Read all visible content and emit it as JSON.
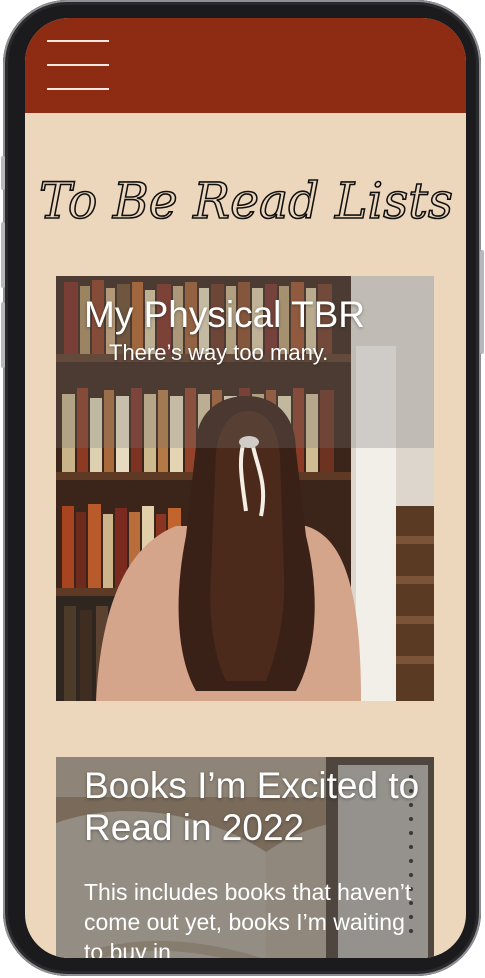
{
  "header": {
    "menu_icon": "hamburger-menu-icon",
    "color": "#8e2c13"
  },
  "page": {
    "title": "To Be Read Lists",
    "background": "#ecd7bd"
  },
  "cards": [
    {
      "title": "My Physical TBR",
      "subtitle": "There’s way too many.",
      "image": "woman-at-bookshelf-photo"
    },
    {
      "title": "Books I’m Excited to Read in 2022",
      "body": "This includes books that haven’t come out yet, books I’m waiting to buy in",
      "image": "open-book-and-notebook-photo"
    }
  ]
}
